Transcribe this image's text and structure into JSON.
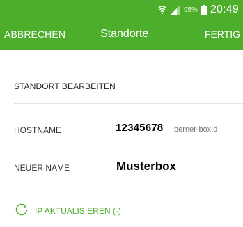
{
  "status_bar": {
    "battery_percent": "95%",
    "time": "20:49",
    "icons": [
      "wifi-icon",
      "signal-icon",
      "battery-icon"
    ]
  },
  "app_bar": {
    "cancel_label": "ABBRECHEN",
    "title": "Standorte",
    "done_label": "FERTIG"
  },
  "form": {
    "section_title": "STANDORT BEARBEITEN",
    "hostname": {
      "label": "HOSTNAME",
      "value": "12345678",
      "suffix": ".berner-box.d"
    },
    "new_name": {
      "label": "NEUER NAME",
      "value": "Musterbox"
    }
  },
  "actions": {
    "refresh_ip_label": "IP AKTUALISIEREN (-)",
    "refresh_icon": "refresh-icon"
  },
  "colors": {
    "accent": "#4cae2a",
    "background": "#ffffff",
    "divider": "#e3e3e3"
  }
}
